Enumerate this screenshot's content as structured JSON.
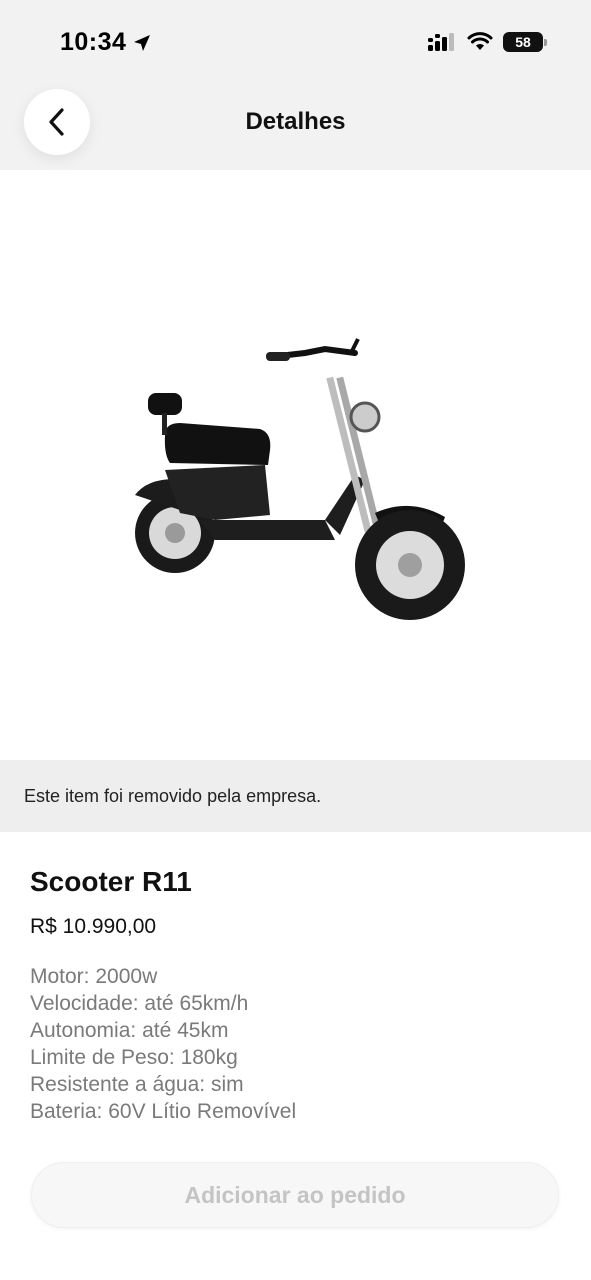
{
  "status_bar": {
    "time": "10:34",
    "battery": "58"
  },
  "nav": {
    "title": "Detalhes"
  },
  "banner": {
    "text": "Este item foi removido pela empresa."
  },
  "product": {
    "name": "Scooter R11",
    "price": "R$ 10.990,00",
    "specs": [
      "Motor: 2000w",
      "Velocidade: até 65km/h",
      "Autonomia: até 45km",
      "Limite de Peso: 180kg",
      "Resistente a água: sim",
      "Bateria: 60V Lítio Removível"
    ]
  },
  "actions": {
    "add_label": "Adicionar ao pedido"
  },
  "colors": {
    "button_text_disabled": "#c4c4c4",
    "banner_bg": "#eeeeee",
    "header_bg": "#f2f2f2"
  },
  "icons": [
    "location-arrow-icon",
    "signal-icon",
    "wifi-icon",
    "battery-icon",
    "back-chevron-icon"
  ]
}
